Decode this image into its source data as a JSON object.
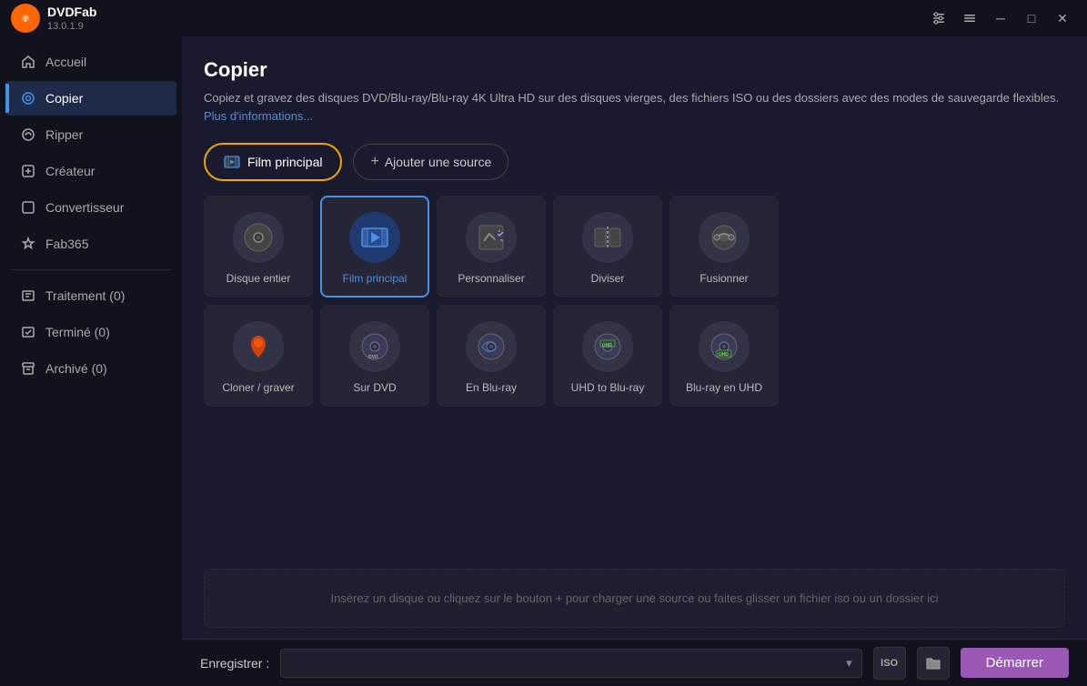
{
  "app": {
    "name": "DVDFab",
    "version": "13.0.1.9"
  },
  "titlebar": {
    "controls": {
      "settings": "⚙",
      "menu": "☰",
      "minimize": "─",
      "maximize": "□",
      "close": "✕"
    }
  },
  "sidebar": {
    "items": [
      {
        "id": "accueil",
        "label": "Accueil",
        "icon": "home"
      },
      {
        "id": "copier",
        "label": "Copier",
        "icon": "copy",
        "active": true
      },
      {
        "id": "ripper",
        "label": "Ripper",
        "icon": "disc"
      },
      {
        "id": "createur",
        "label": "Créateur",
        "icon": "create"
      },
      {
        "id": "convertisseur",
        "label": "Convertisseur",
        "icon": "convert"
      },
      {
        "id": "fab365",
        "label": "Fab365",
        "icon": "star"
      }
    ],
    "queue_items": [
      {
        "id": "traitement",
        "label": "Traitement (0)",
        "icon": "queue"
      },
      {
        "id": "termine",
        "label": "Terminé (0)",
        "icon": "done"
      },
      {
        "id": "archive",
        "label": "Archivé (0)",
        "icon": "archive"
      }
    ]
  },
  "content": {
    "title": "Copier",
    "description": "Copiez et gravez des disques DVD/Blu-ray/Blu-ray 4K Ultra HD sur des disques vierges, des fichiers ISO ou des dossiers avec des modes de sauvegarde flexibles.",
    "more_info_link": "Plus d'informations..."
  },
  "action_bar": {
    "main_button": "Film principal",
    "add_button": "Ajouter une source"
  },
  "modes": [
    {
      "id": "disque-entier",
      "label": "Disque entier",
      "icon": "💿",
      "selected": false
    },
    {
      "id": "film-principal",
      "label": "Film principal",
      "icon": "🎬",
      "selected": true
    },
    {
      "id": "personnaliser",
      "label": "Personnaliser",
      "icon": "✏️",
      "selected": false
    },
    {
      "id": "diviser",
      "label": "Diviser",
      "icon": "✂",
      "selected": false
    },
    {
      "id": "fusionner",
      "label": "Fusionner",
      "icon": "🔗",
      "selected": false
    },
    {
      "id": "cloner-graver",
      "label": "Cloner / graver",
      "icon": "🔥",
      "selected": false
    },
    {
      "id": "sur-dvd",
      "label": "Sur DVD",
      "icon": "📀",
      "selected": false
    },
    {
      "id": "en-blu-ray",
      "label": "En Blu-ray",
      "icon": "💿",
      "selected": false
    },
    {
      "id": "uhd-to-blu-ray",
      "label": "UHD to Blu-ray",
      "icon": "📀",
      "selected": false
    },
    {
      "id": "blu-ray-en-uhd",
      "label": "Blu-ray en UHD",
      "icon": "💿",
      "selected": false
    }
  ],
  "drop_zone": {
    "text": "Insérez un disque ou cliquez sur le bouton +  pour charger une source ou faites glisser un fichier iso ou un dossier ici"
  },
  "bottom_bar": {
    "save_label": "Enregistrer :",
    "start_button": "Démarrer",
    "iso_icon": "ISO",
    "folder_icon": "📁"
  }
}
